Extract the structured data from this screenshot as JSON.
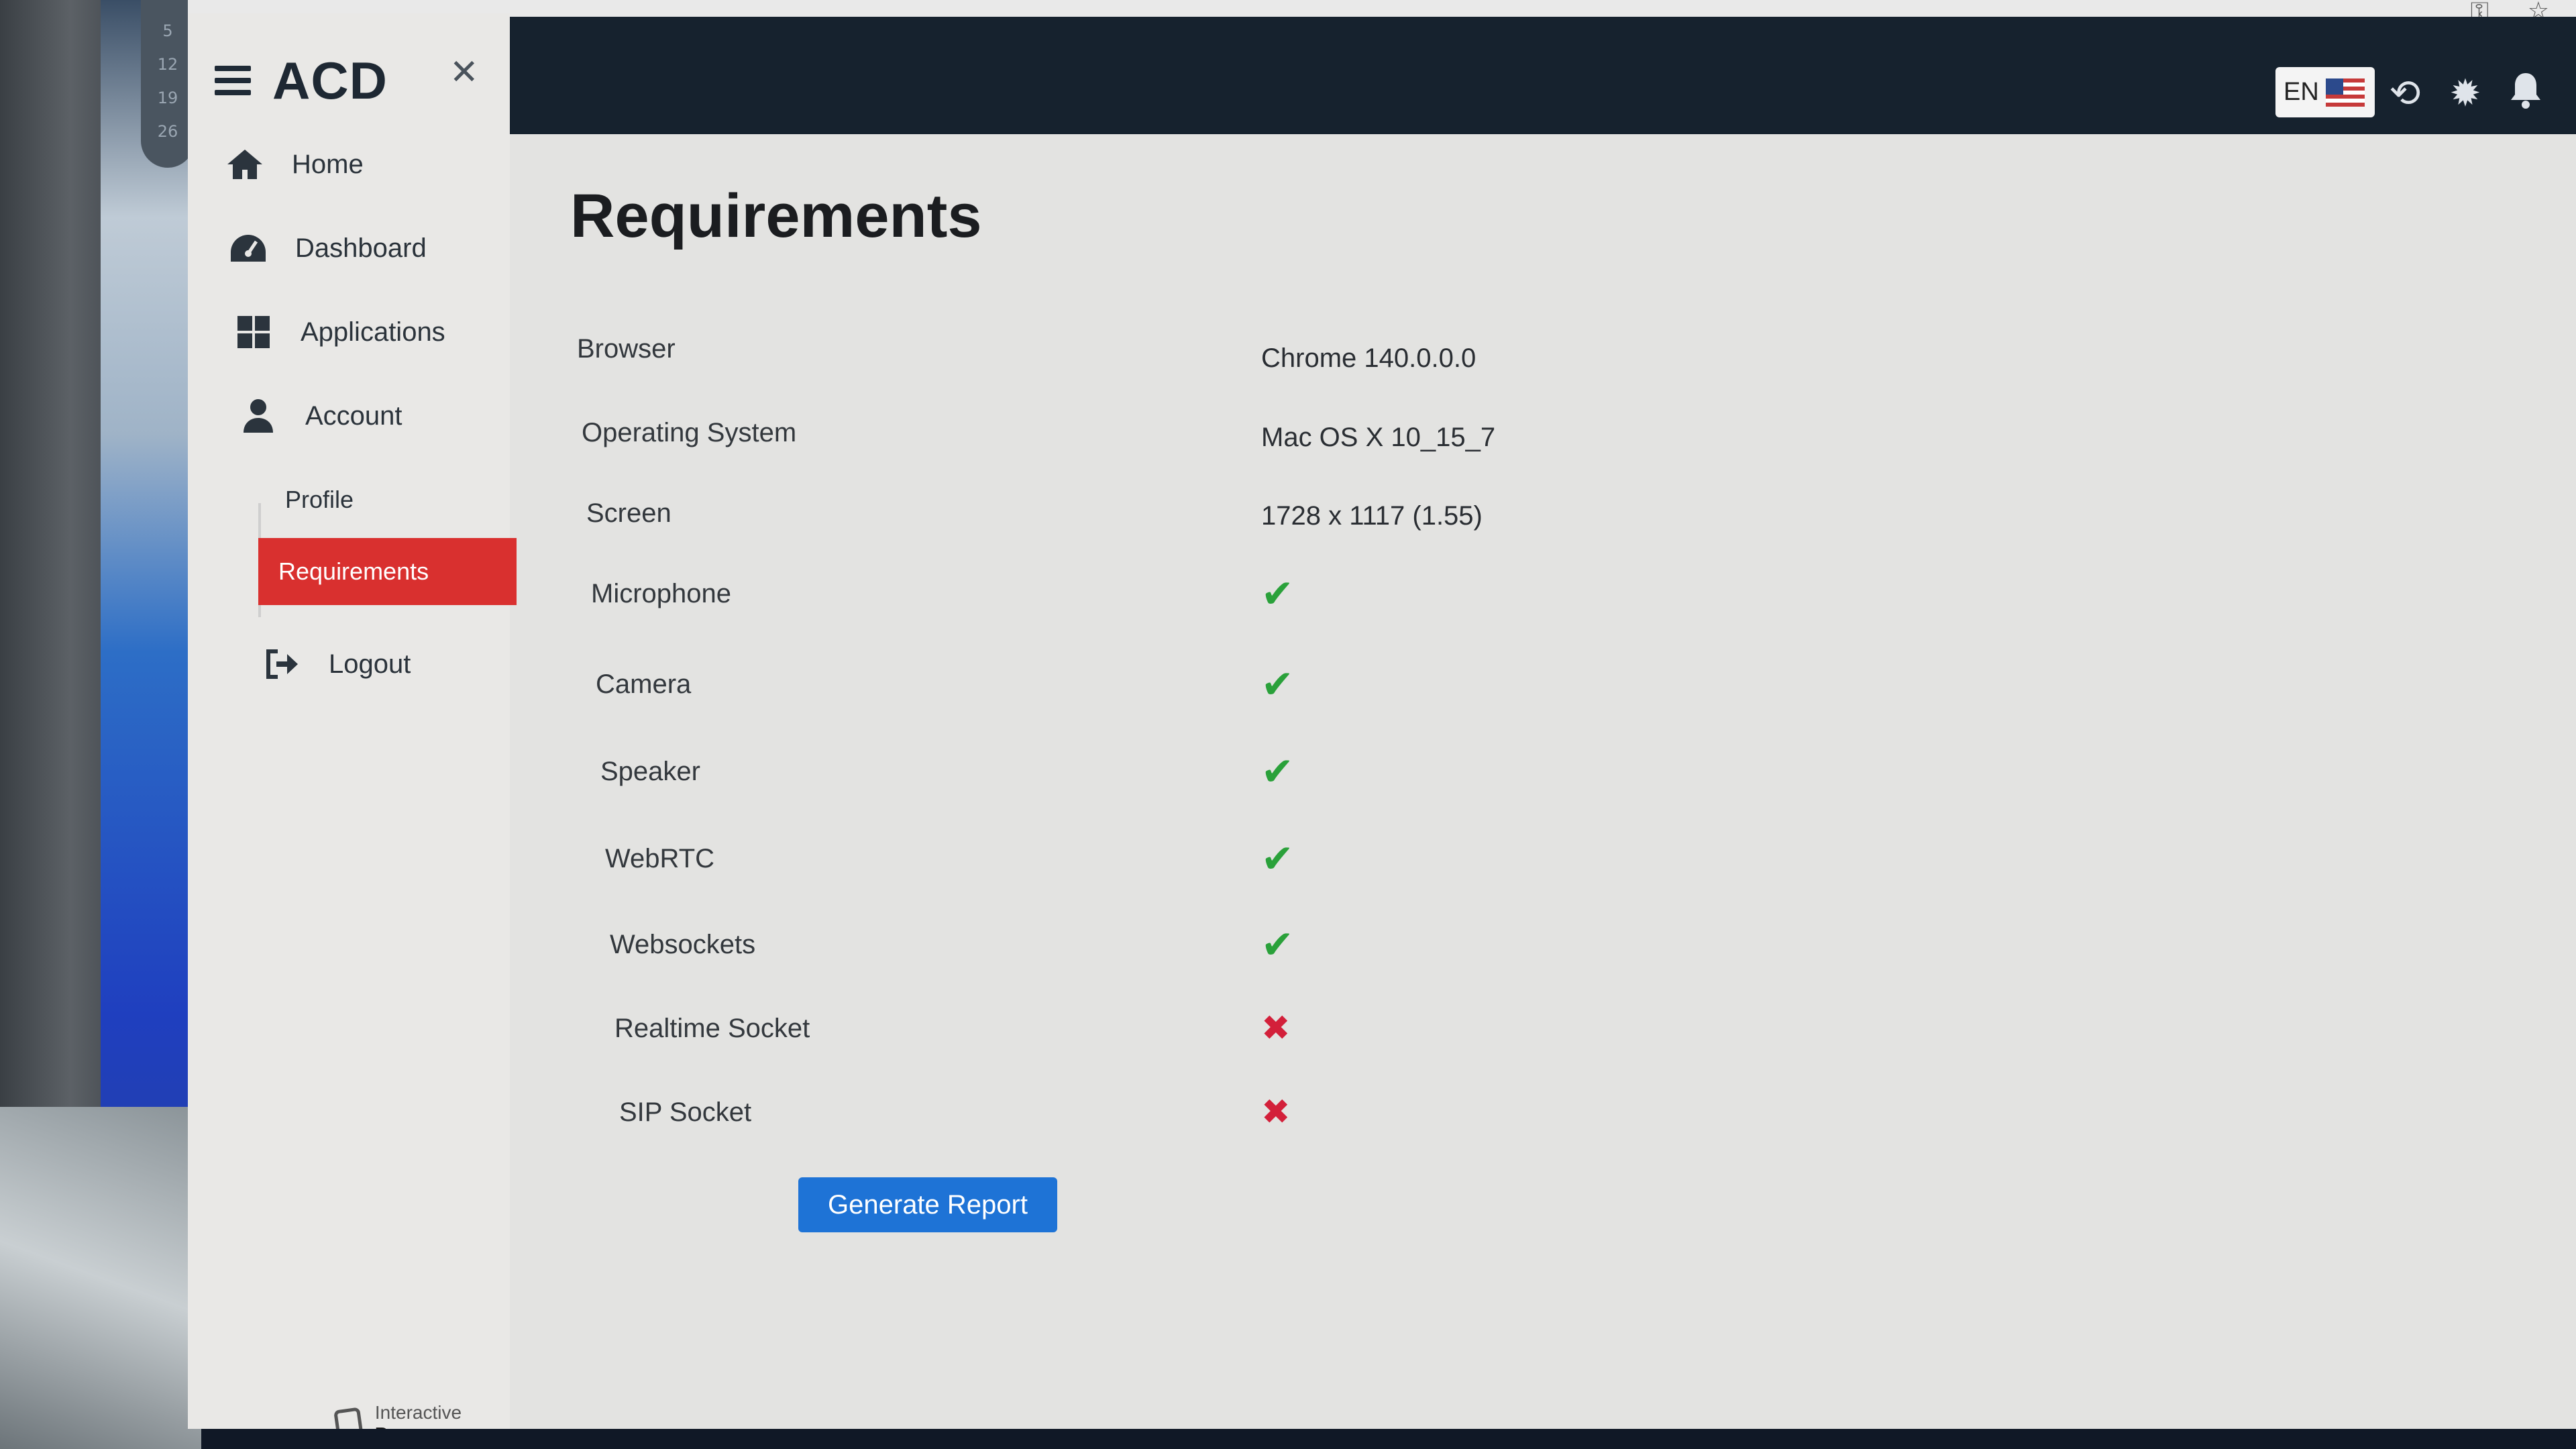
{
  "calendar": {
    "numbers": [
      "5",
      "12",
      "19",
      "26"
    ]
  },
  "app": {
    "title": "ACD"
  },
  "language": {
    "code": "EN"
  },
  "sidebar": {
    "items": [
      {
        "label": "Home",
        "icon": "home-icon"
      },
      {
        "label": "Dashboard",
        "icon": "dashboard-icon"
      },
      {
        "label": "Applications",
        "icon": "applications-icon"
      },
      {
        "label": "Account",
        "icon": "account-icon"
      }
    ],
    "subitems": [
      {
        "label": "Profile",
        "active": false
      },
      {
        "label": "Requirements",
        "active": true
      }
    ],
    "logout": {
      "label": "Logout",
      "icon": "logout-icon"
    }
  },
  "footer": {
    "brand_prefix": "Interactive",
    "brand_name": "Powers"
  },
  "page": {
    "title": "Requirements"
  },
  "requirements": [
    {
      "label": "Browser",
      "value": "Chrome 140.0.0.0"
    },
    {
      "label": "Operating System",
      "value": "Mac OS X 10_15_7"
    },
    {
      "label": "Screen",
      "value": "1728 x 1117 (1.55)"
    },
    {
      "label": "Microphone",
      "status": "ok"
    },
    {
      "label": "Camera",
      "status": "ok"
    },
    {
      "label": "Speaker",
      "status": "ok"
    },
    {
      "label": "WebRTC",
      "status": "ok"
    },
    {
      "label": "Websockets",
      "status": "ok"
    },
    {
      "label": "Realtime Socket",
      "status": "fail"
    },
    {
      "label": "SIP Socket",
      "status": "fail"
    }
  ],
  "actions": {
    "generate_report_label": "Generate Report"
  },
  "colors": {
    "topbar": "#16222e",
    "active_nav": "#d9302f",
    "primary_button": "#1e73d6",
    "ok": "#2aa13a",
    "fail": "#d3203a"
  }
}
